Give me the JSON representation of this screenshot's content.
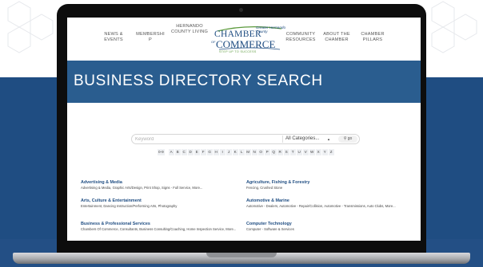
{
  "nav": {
    "news_events": "NEWS & EVENTS",
    "membership": "MEMBERSHI P",
    "hernando_living": "HERNANDO COUNTY LIVING",
    "community_resources": "COMMUNITY RESOURCES",
    "about": "ABOUT THE CHAMBER",
    "pillars": "CHAMBER PILLARS"
  },
  "logo": {
    "line1": "CHAMBER",
    "line2": "COMMERCE",
    "of": "OF",
    "small": "Greater Hernando County",
    "tagline": "Step up to success"
  },
  "banner": {
    "title": "BUSINESS DIRECTORY SEARCH"
  },
  "search": {
    "placeholder": "Keyword",
    "category_value": "All Categories...",
    "go_label": "go"
  },
  "alphabet": [
    "0-9",
    "A",
    "B",
    "C",
    "D",
    "E",
    "F",
    "G",
    "H",
    "I",
    "J",
    "K",
    "L",
    "M",
    "N",
    "O",
    "P",
    "Q",
    "R",
    "S",
    "T",
    "U",
    "V",
    "W",
    "X",
    "Y",
    "Z"
  ],
  "categories": [
    {
      "title": "Advertising & Media",
      "sub": "Advertising & Media, Graphic Arts/Design, Print Shop, Signs - Full Service, More..."
    },
    {
      "title": "Agriculture, Fishing & Forestry",
      "sub": "Fencing, Crushed Stone"
    },
    {
      "title": "Arts, Culture & Entertainment",
      "sub": "Entertainment, Dancing Instruction/Performing Arts, Photography"
    },
    {
      "title": "Automotive & Marine",
      "sub": "Automotive - Dealers, Automotive - Repair/Collision, Automotive - Transmissions, Auto Clubs, More..."
    },
    {
      "title": "Business & Professional Services",
      "sub": "Chambers Of Commerce, Consultants, Business Consulting/Coaching, Home Inspection Service, More..."
    },
    {
      "title": "Computer Technology",
      "sub": "Computer - Software & Services"
    }
  ],
  "colors": {
    "navy": "#1f4d82",
    "banner": "#2a5d8f",
    "green": "#5b9a3c"
  }
}
